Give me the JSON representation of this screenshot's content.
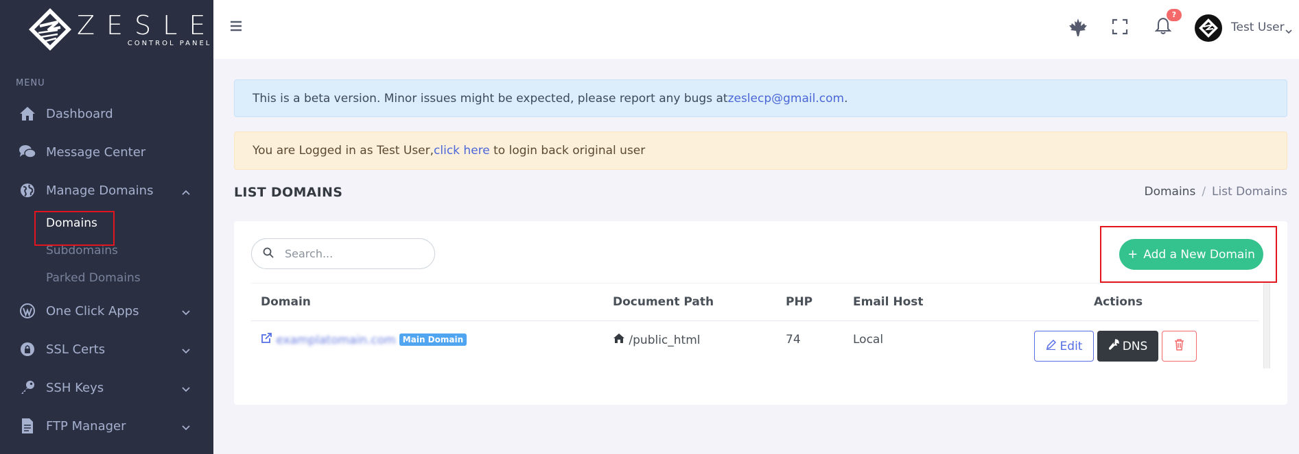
{
  "brand": {
    "name": "ZESLE",
    "subtitle": "CONTROL PANEL"
  },
  "sidebar": {
    "menu_title": "MENU",
    "items": [
      {
        "label": "Dashboard",
        "icon": "home-icon"
      },
      {
        "label": "Message Center",
        "icon": "chat-icon"
      },
      {
        "label": "Manage Domains",
        "icon": "globe-icon",
        "expanded": true,
        "children": [
          "Domains",
          "Subdomains",
          "Parked Domains"
        ],
        "active_child": "Domains"
      },
      {
        "label": "One Click Apps",
        "icon": "wordpress-icon"
      },
      {
        "label": "SSL Certs",
        "icon": "lock-icon"
      },
      {
        "label": "SSH Keys",
        "icon": "key-icon"
      },
      {
        "label": "FTP Manager",
        "icon": "file-icon"
      }
    ]
  },
  "topbar": {
    "notification_count": "?",
    "user_name": "Test User"
  },
  "alerts": {
    "info_text": "This is a beta version. Minor issues might be expected, please report any bugs at ",
    "info_email": "zeslecp@gmail.com",
    "info_end": ".",
    "warn_text": "You are Logged in as Test User, ",
    "warn_link": "click here",
    "warn_end": " to login back original user"
  },
  "page": {
    "title": "LIST DOMAINS",
    "breadcrumb": [
      "Domains",
      "List Domains"
    ]
  },
  "search": {
    "placeholder": "Search..."
  },
  "add_button": "Add a New Domain",
  "table": {
    "headers": [
      "Domain",
      "Document Path",
      "PHP",
      "Email Host",
      "Actions"
    ],
    "rows": [
      {
        "domain": "examplatomain.com",
        "badge": "Main Domain",
        "path": "/public_html",
        "php": "74",
        "email_host": "Local"
      }
    ],
    "actions": {
      "edit": "Edit",
      "dns": "DNS"
    }
  },
  "colors": {
    "sidebar": "#2a3042",
    "success": "#34c38f",
    "primary": "#556ee6",
    "danger": "#f46a6a",
    "highlight": "#e3141d"
  }
}
